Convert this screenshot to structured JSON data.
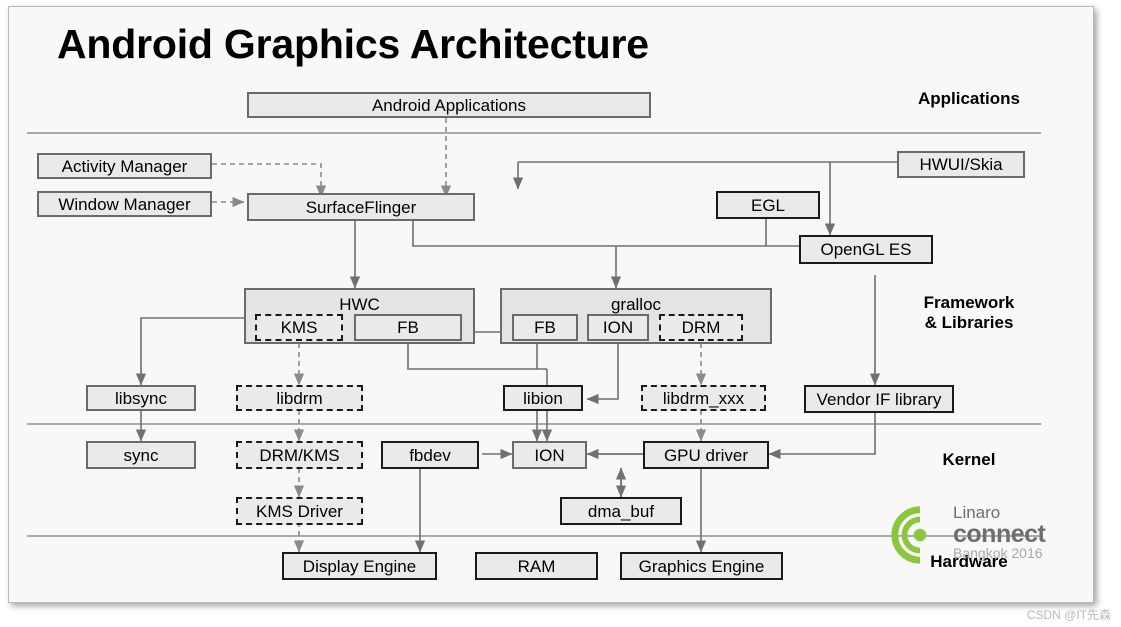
{
  "slide": {
    "title": "Android Graphics Architecture",
    "background_color": "#f8f8f8",
    "node_fill": "#eaeaea"
  },
  "section_labels": [
    {
      "name": "applications",
      "text": "Applications"
    },
    {
      "name": "framework",
      "text": "Framework\n& Libraries"
    },
    {
      "name": "kernel",
      "text": "Kernel"
    },
    {
      "name": "hardware",
      "text": "Hardware"
    }
  ],
  "nodes": {
    "android_applications": "Android Applications",
    "activity_manager": "Activity Manager",
    "window_manager": "Window Manager",
    "surfaceflinger": "SurfaceFlinger",
    "hwui_skia": "HWUI/Skia",
    "egl": "EGL",
    "opengl_es": "OpenGL ES",
    "hwc": "HWC",
    "hwc_kms": "KMS",
    "hwc_fb": "FB",
    "gralloc": "gralloc",
    "gralloc_fb": "FB",
    "gralloc_ion": "ION",
    "gralloc_drm": "DRM",
    "libsync": "libsync",
    "libdrm": "libdrm",
    "libion": "libion",
    "libdrm_xxx": "libdrm_xxx",
    "vendor_if_library": "Vendor IF library",
    "sync": "sync",
    "drm_kms": "DRM/KMS",
    "fbdev": "fbdev",
    "ion": "ION",
    "gpu_driver": "GPU driver",
    "kms_driver": "KMS Driver",
    "dma_buf": "dma_buf",
    "display_engine": "Display Engine",
    "ram": "RAM",
    "graphics_engine": "Graphics Engine"
  },
  "logo": {
    "line1": "Linaro",
    "line2": "connect",
    "line3": "Bangkok 2016",
    "color": "#8cc63f"
  },
  "watermark": "CSDN @IT先森"
}
